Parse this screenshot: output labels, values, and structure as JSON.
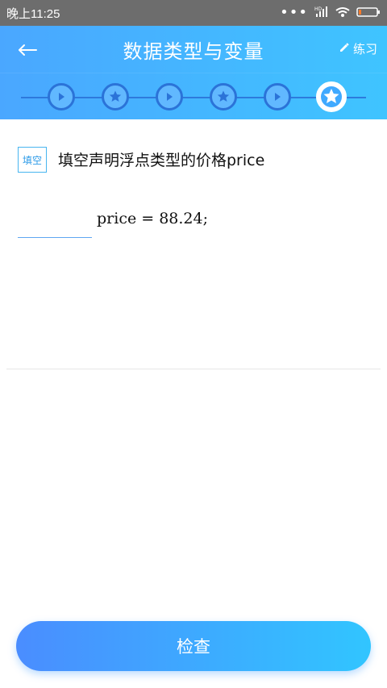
{
  "status": {
    "time": "晚上11:25",
    "network": "HD",
    "icons": [
      "more-dots-icon",
      "signal-icon",
      "wifi-icon",
      "battery-icon"
    ]
  },
  "header": {
    "title": "数据类型与变量",
    "practice_label": "练习",
    "back_icon": "back-arrow-icon",
    "practice_icon": "pencil-icon",
    "accent": "#3fb4ff"
  },
  "steps": [
    {
      "type": "play",
      "active": false
    },
    {
      "type": "star",
      "active": false
    },
    {
      "type": "play",
      "active": false
    },
    {
      "type": "star",
      "active": false
    },
    {
      "type": "play",
      "active": false
    },
    {
      "type": "star",
      "active": true
    }
  ],
  "question": {
    "tag": "填空",
    "text": "填空声明浮点类型的价格price",
    "code_text": "price = 88.24;",
    "blank_value": ""
  },
  "footer": {
    "check_label": "检查"
  }
}
